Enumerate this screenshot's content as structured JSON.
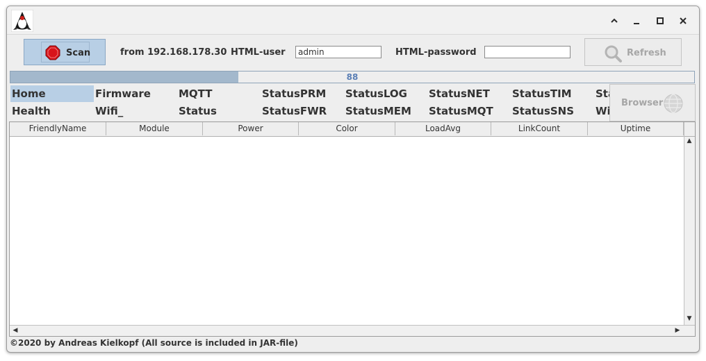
{
  "titlebar": {
    "app_icon": "java-duke-icon",
    "controls": {
      "up": "chevron-up-icon",
      "minimize": "minimize-icon",
      "maximize": "maximize-icon",
      "close": "close-icon"
    }
  },
  "toolbar": {
    "scan_label": "Scan",
    "scan_icon": "stop-sign-icon",
    "from_text": "from 192.168.178.30",
    "html_user_label": "HTML-user",
    "html_user_value": "admin",
    "html_password_label": "HTML-password",
    "html_password_value": "",
    "refresh_label": "Refresh",
    "refresh_icon": "magnifier-icon"
  },
  "progress": {
    "text": "88",
    "fraction": 0.333
  },
  "commands": {
    "row1": [
      "Home",
      "Firmware",
      "MQTT",
      "StatusPRM",
      "StatusLOG",
      "StatusNET",
      "StatusTIM",
      "Sta"
    ],
    "row2": [
      "Health",
      "Wifi_",
      "Status",
      "StatusFWR",
      "StatusMEM",
      "StatusMQT",
      "StatusSNS",
      "Wi"
    ],
    "active": "Home"
  },
  "browser": {
    "label": "Browser",
    "icon": "globe-icon"
  },
  "table": {
    "columns": [
      "FriendlyName",
      "Module",
      "Power",
      "Color",
      "LoadAvg",
      "LinkCount",
      "Uptime"
    ],
    "rows": []
  },
  "footer": {
    "text": "©2020 by Andreas Kielkopf (All source is included in JAR-file)"
  },
  "colors": {
    "selection": "#b8cfe5",
    "progress_fill": "#a3b8cc",
    "progress_text": "#5a7fb5"
  }
}
